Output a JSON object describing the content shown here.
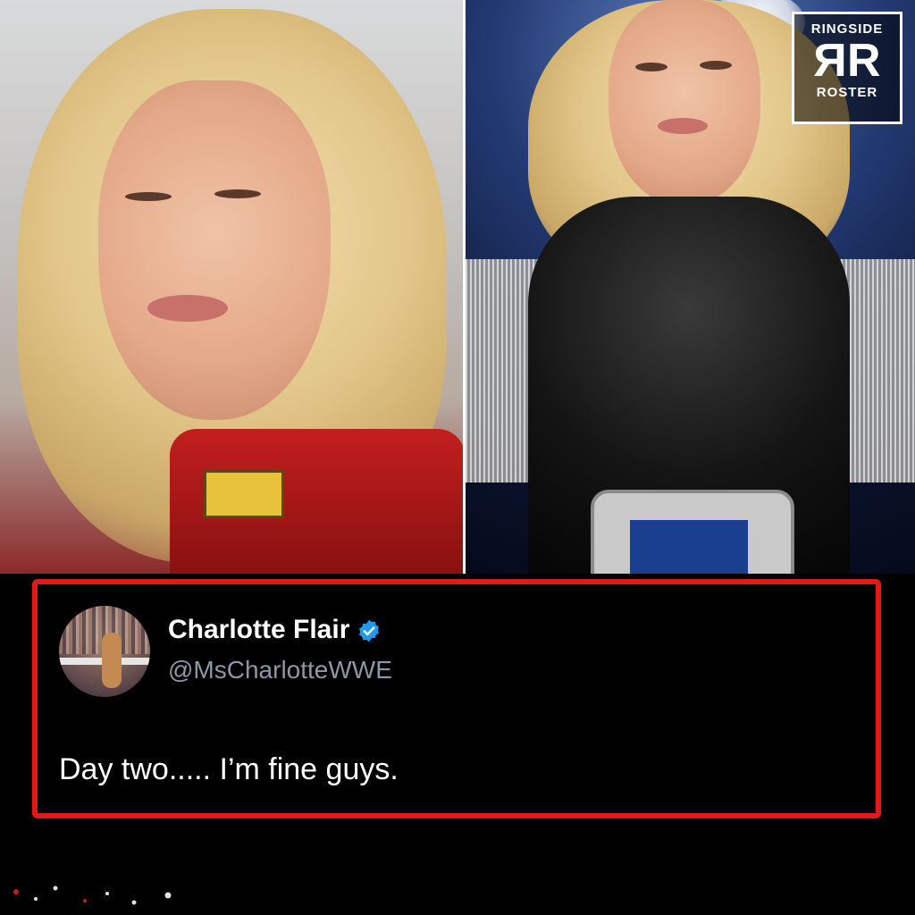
{
  "brand": {
    "logo_top": "RINGSIDE",
    "logo_mark_left": "R",
    "logo_mark_right": "R",
    "logo_bottom": "ROSTER",
    "card_border_color": "#e11919"
  },
  "tweet": {
    "display_name": "Charlotte Flair",
    "handle": "@MsCharlotteWWE",
    "text": "Day two..... I’m fine guys.",
    "verified_icon": "verified-badge-icon",
    "verified_color": "#1d9bf0"
  }
}
